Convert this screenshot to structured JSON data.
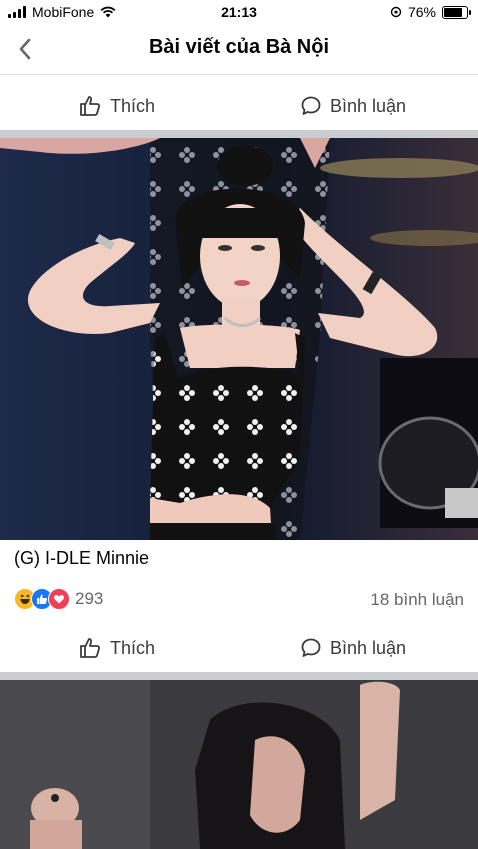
{
  "status_bar": {
    "carrier": "MobiFone",
    "time": "21:13",
    "battery_percent": "76%",
    "battery_level": 0.76
  },
  "nav": {
    "title": "Bài viết của Bà Nội",
    "back_icon": "chevron-left-icon"
  },
  "actions": {
    "like_label": "Thích",
    "comment_label": "Bình luận"
  },
  "post": {
    "caption": "(G) I-DLE Minnie",
    "reaction_count": "293",
    "comment_count": "18 bình luận",
    "reaction_icons": [
      "haha-icon",
      "like-icon",
      "love-icon"
    ]
  },
  "colors": {
    "separator": "#c9ccd1",
    "like_blue": "#1877f2",
    "love_red": "#f33e58",
    "haha_yellow": "#f7b928"
  }
}
